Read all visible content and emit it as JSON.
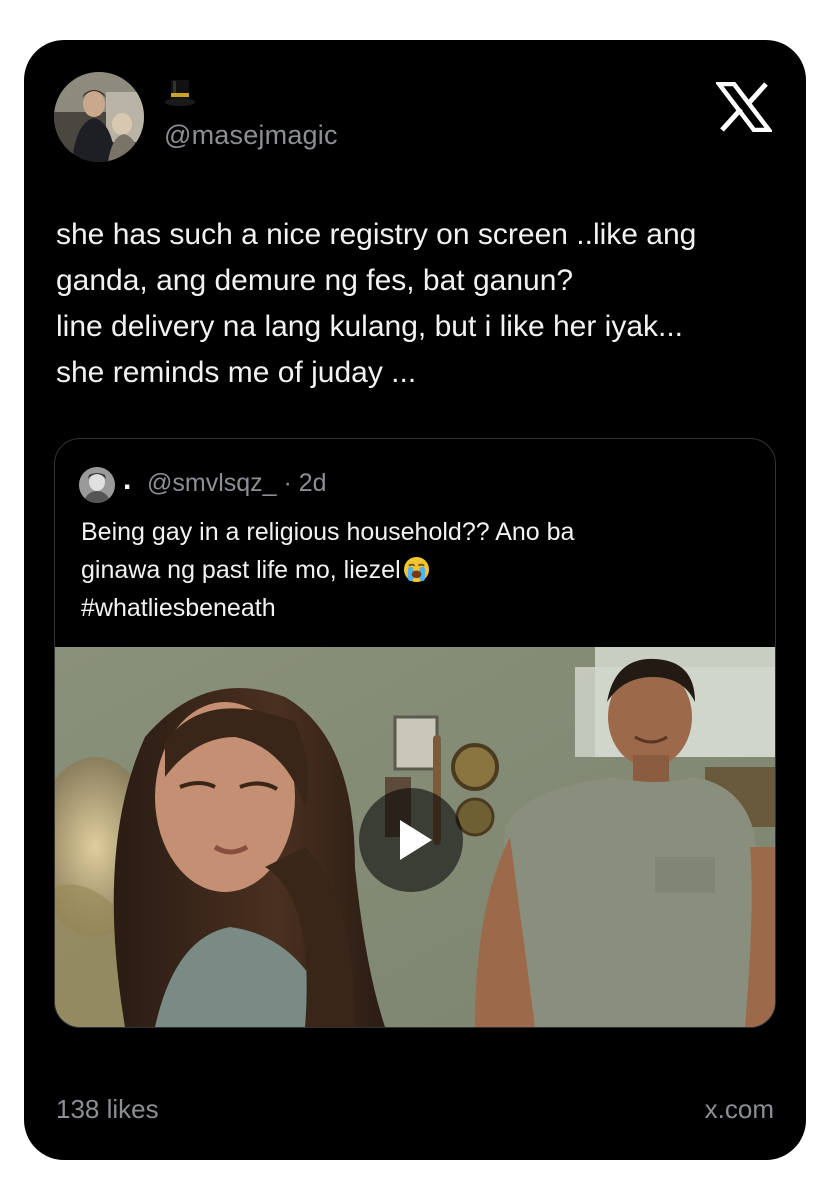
{
  "post": {
    "handle": "@masejmagic",
    "lines": [
      "she has such a nice registry on screen ..like ang",
      "ganda, ang demure ng fes, bat ganun?",
      "line delivery na lang kulang, but i like her iyak...",
      "she reminds me of juday ..."
    ]
  },
  "quoted": {
    "display_name": ".",
    "handle_meta": "@smvlsqz_ · 2d",
    "lines": [
      "Being gay in a religious household?? Ano ba",
      "ginawa ng past life mo, liezel",
      "#whatliesbeneath"
    ],
    "emoji": "loudly-crying-face"
  },
  "footer": {
    "likes": "138 likes",
    "domain": "x.com"
  },
  "icons": {
    "logo": "x-logo-icon",
    "hat": "top-hat-icon",
    "play": "play-icon"
  },
  "colors": {
    "background": "#000000",
    "text": "#f2f2f2",
    "muted": "#8b8f94",
    "border": "#2f3336"
  }
}
